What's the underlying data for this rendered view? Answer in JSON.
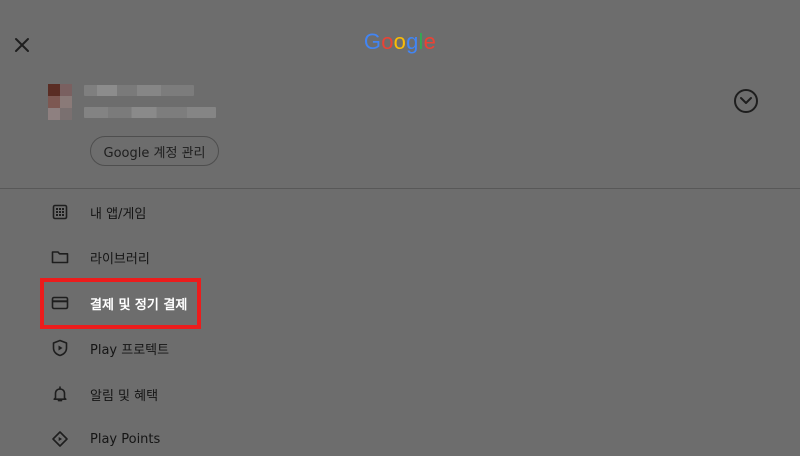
{
  "header": {
    "close_icon": "close-icon",
    "logo_letters": [
      {
        "char": "G",
        "color": "#4285F4"
      },
      {
        "char": "o",
        "color": "#EA4335"
      },
      {
        "char": "o",
        "color": "#FBBC05"
      },
      {
        "char": "g",
        "color": "#4285F4"
      },
      {
        "char": "l",
        "color": "#34A853"
      },
      {
        "char": "e",
        "color": "#EA4335"
      }
    ]
  },
  "account": {
    "avatar_icon": "avatar",
    "expand_icon": "chevron-down-icon",
    "manage_label": "Google 계정 관리"
  },
  "menu": {
    "items": [
      {
        "label": "내 앱/게임",
        "icon": "apps-grid-icon"
      },
      {
        "label": "라이브러리",
        "icon": "folder-icon"
      },
      {
        "label": "결제 및 정기 결제",
        "icon": "credit-card-icon"
      },
      {
        "label": "Play 프로텍트",
        "icon": "shield-icon"
      },
      {
        "label": "알림 및 혜택",
        "icon": "bell-icon"
      },
      {
        "label": "Play Points",
        "icon": "diamond-icon"
      }
    ]
  },
  "colors": {
    "overlay": "#6d6d6d",
    "highlight": "#ec1c1c",
    "icon": "#1e1e1e"
  }
}
